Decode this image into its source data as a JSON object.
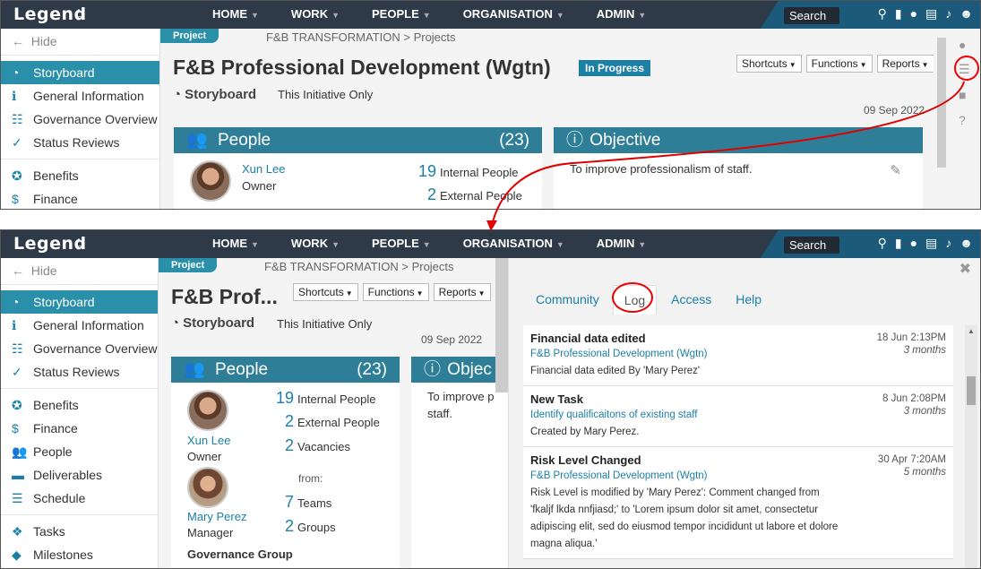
{
  "app": {
    "logo": "Legend"
  },
  "nav": [
    "HOME",
    "WORK",
    "PEOPLE",
    "ORGANISATION",
    "ADMIN"
  ],
  "search": {
    "label": "Search"
  },
  "sidebar": {
    "hide": "Hide",
    "items": [
      "Storyboard",
      "General Information",
      "Governance Overview",
      "Status Reviews",
      "Benefits",
      "Finance",
      "People",
      "Deliverables",
      "Schedule",
      "Tasks",
      "Milestones"
    ]
  },
  "page": {
    "tag": "Project",
    "breadcrumb": "F&B TRANSFORMATION > Projects",
    "title": "F&B Professional Development (Wgtn)",
    "title_short": "F&B Prof...",
    "status": "In Progress",
    "buttons": [
      "Shortcuts",
      "Functions",
      "Reports"
    ],
    "storyboard": "Storyboard",
    "scope": "This Initiative Only",
    "date": "09 Sep 2022"
  },
  "people": {
    "heading": "People",
    "count": "(23)",
    "person1": {
      "name": "Xun Lee",
      "role": "Owner"
    },
    "person2": {
      "name": "Mary Perez",
      "role": "Manager"
    },
    "stats": [
      {
        "num": "19",
        "label": "Internal People"
      },
      {
        "num": "2",
        "label": "External People"
      },
      {
        "num": "2",
        "label": "Vacancies"
      }
    ],
    "from": "from:",
    "teams": {
      "num": "7",
      "label": "Teams"
    },
    "groups": {
      "num": "2",
      "label": "Groups"
    },
    "governance": "Governance Group"
  },
  "objective": {
    "heading": "Objective",
    "heading_short": "Objec",
    "text": "To improve professionalism of staff.",
    "text_line1": "To improve p",
    "text_line2": "staff."
  },
  "log": {
    "tabs": [
      "Community",
      "Log",
      "Access",
      "Help"
    ],
    "entries": [
      {
        "title": "Financial data edited",
        "link": "F&B Professional Development (Wgtn)",
        "desc": "Financial data edited By 'Mary Perez'",
        "date": "18 Jun 2:13PM",
        "ago": "3 months"
      },
      {
        "title": "New Task",
        "link": "Identify qualificaitons of existing staff",
        "desc": "Created by Mary Perez.",
        "date": "8 Jun 2:08PM",
        "ago": "3 months"
      },
      {
        "title": "Risk Level Changed",
        "link": "F&B Professional Development (Wgtn)",
        "desc": "Risk Level is modified by 'Mary Perez': Comment changed from 'fkaljf lkda nnfjiasd;' to 'Lorem ipsum dolor sit amet, consectetur adipiscing elit, sed do eiusmod tempor incididunt ut labore et dolore magna aliqua.'",
        "date": "30 Apr 7:20AM",
        "ago": "5 months"
      }
    ]
  },
  "colors": {
    "nav": "#2e3a48",
    "accent": "#2a8fa9",
    "link": "#1b7fa6",
    "annotation": "#e00000"
  }
}
